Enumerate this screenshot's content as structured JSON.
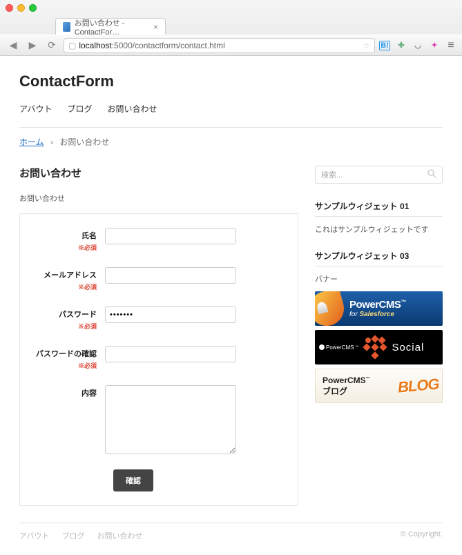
{
  "browser": {
    "tab_title": "お問い合わせ - ContactFor…",
    "url_host": "localhost",
    "url_path": ":5000/contactform/contact.html",
    "ext_b": "B!"
  },
  "site_title": "ContactForm",
  "nav": {
    "about": "アバウト",
    "blog": "ブログ",
    "contact": "お問い合わせ"
  },
  "breadcrumb": {
    "home": "ホーム",
    "sep": "›",
    "current": "お問い合わせ"
  },
  "heading": "お問い合わせ",
  "subheading": "お問い合わせ",
  "required_label": "※必須",
  "form": {
    "name_label": "氏名",
    "name_value": "",
    "email_label": "メールアドレス",
    "email_value": "",
    "password_label": "パスワード",
    "password_value": "•••••••",
    "password_confirm_label": "パスワードの確認",
    "password_confirm_value": "",
    "content_label": "内容",
    "content_value": "",
    "submit": "確認"
  },
  "sidebar": {
    "search_placeholder": "検索...",
    "widget1_title": "サンプルウィジェット 01",
    "widget1_text": "これはサンプルウィジェットです",
    "widget3_title": "サンプルウィジェット 03",
    "widget3_sublabel": "バナー",
    "banner_sf_l1": "PowerCMS",
    "banner_sf_l2a": "for ",
    "banner_sf_l2b": "Salesforce",
    "banner_social_brand": "PowerCMS",
    "banner_social_text": "Social",
    "banner_blog_l1": "PowerCMS",
    "banner_blog_l2": "ブログ",
    "banner_blog_right": "BLOG"
  },
  "footer": {
    "about": "アバウト",
    "blog": "ブログ",
    "contact": "お問い合わせ",
    "copyright": "© Copyright."
  }
}
